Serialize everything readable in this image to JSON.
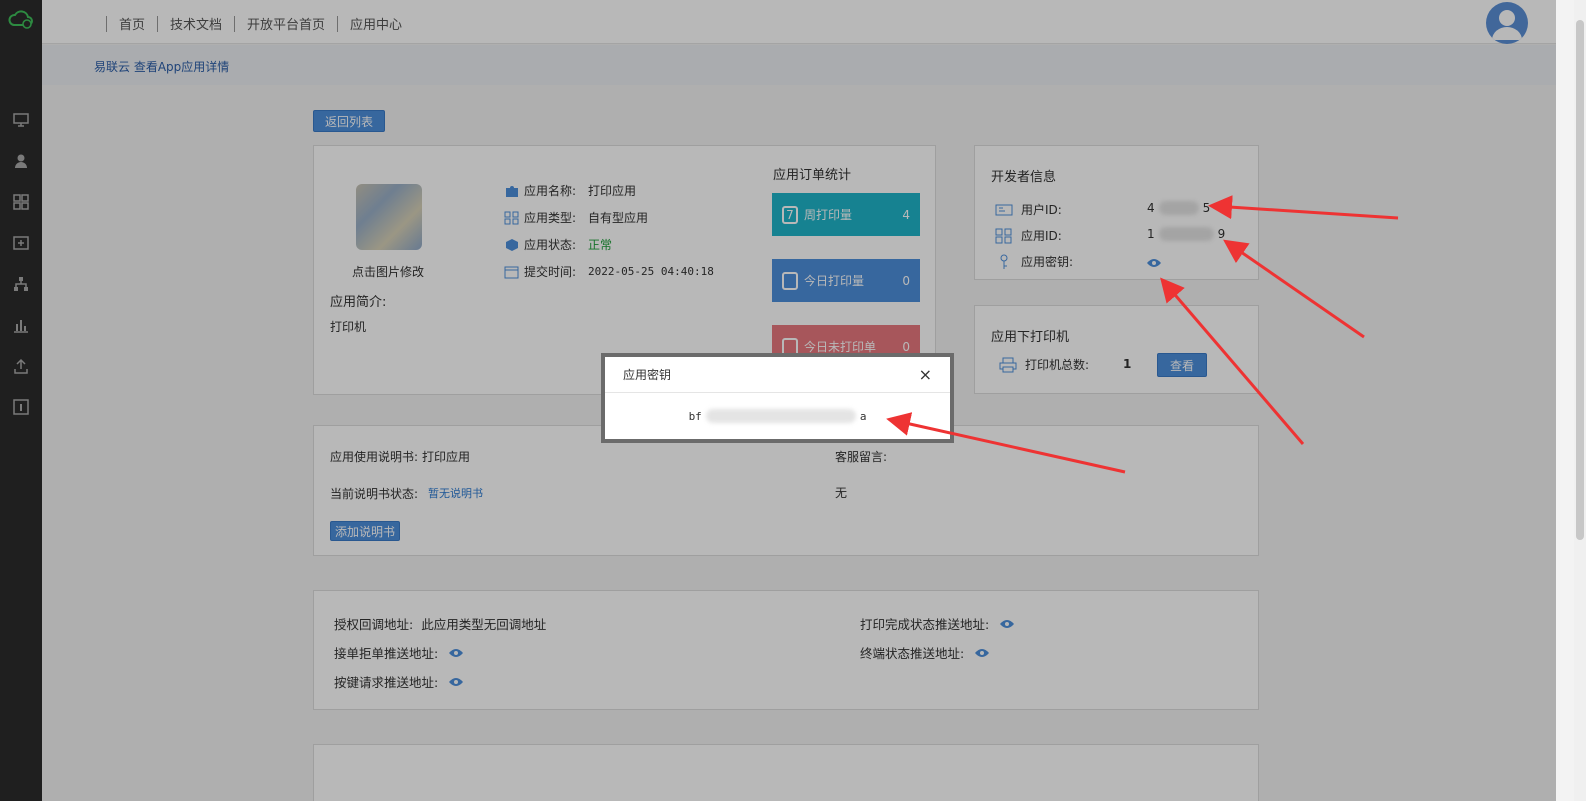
{
  "topnav": {
    "items": [
      "首页",
      "技术文档",
      "开放平台首页",
      "应用中心"
    ]
  },
  "breadcrumb": "易联云 查看App应用详情",
  "back_button": "返回列表",
  "app": {
    "change_image_hint": "点击图片修改",
    "name_label": "应用名称:",
    "name_value": "打印应用",
    "type_label": "应用类型:",
    "type_value": "自有型应用",
    "status_label": "应用状态:",
    "status_value": "正常",
    "submit_label": "提交时间:",
    "submit_value": "2022-05-25 04:40:18",
    "intro_label": "应用简介:",
    "intro_value": "打印机"
  },
  "stats": {
    "title": "应用订单统计",
    "weekly_label": "周打印量",
    "weekly_value": "4",
    "today_label": "今日打印量",
    "today_value": "0",
    "unprinted_label": "今日未打印单",
    "unprinted_value": "0"
  },
  "developer": {
    "title": "开发者信息",
    "user_id_label": "用户ID:",
    "user_id_head": "4",
    "user_id_tail": "5",
    "app_id_label": "应用ID:",
    "app_id_head": "1",
    "app_id_tail": "9",
    "secret_label": "应用密钥:"
  },
  "printers": {
    "title": "应用下打印机",
    "total_label": "打印机总数:",
    "total_value": "1",
    "view_button": "查看"
  },
  "manual": {
    "manual_label": "应用使用说明书:",
    "manual_value": "打印应用",
    "status_label": "当前说明书状态:",
    "status_value": "暂无说明书",
    "add_button": "添加说明书",
    "message_label": "客服留言:",
    "message_value": "无"
  },
  "urls": {
    "callback_label": "授权回调地址:",
    "callback_value": "此应用类型无回调地址",
    "order_push_label": "接单拒单推送地址:",
    "button_push_label": "按键请求推送地址:",
    "print_done_label": "打印完成状态推送地址:",
    "terminal_label": "终端状态推送地址:"
  },
  "modal": {
    "title": "应用密钥",
    "secret_head": "bf",
    "secret_tail": "a",
    "close": "×"
  },
  "colors": {
    "teal": "#1fb5c9",
    "blue": "#4d8fdc",
    "red": "#e8787f",
    "status_green": "#1e9e3a",
    "link_blue": "#2b7ad1"
  }
}
